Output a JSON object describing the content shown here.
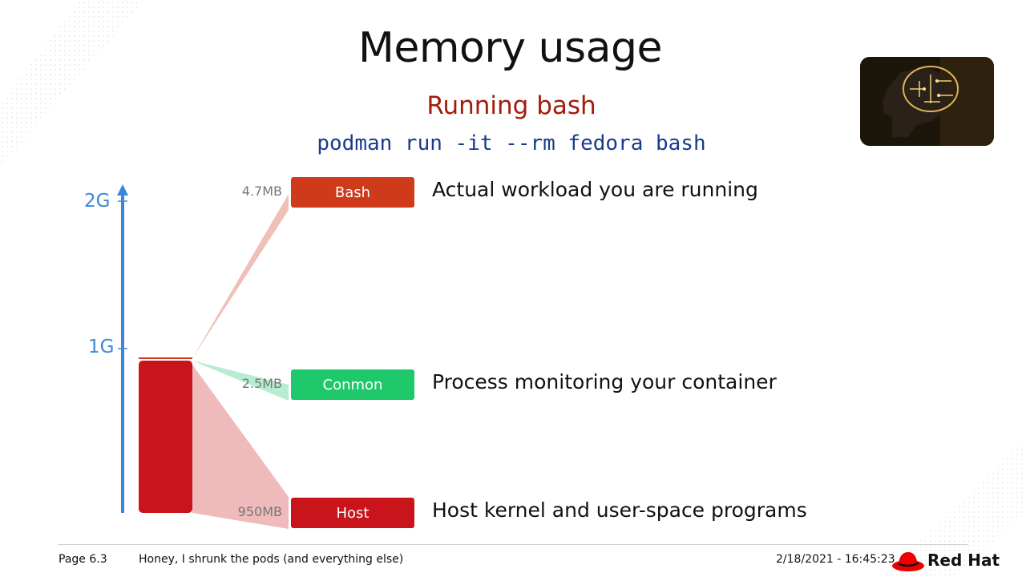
{
  "slide": {
    "title": "Memory usage",
    "subtitle": "Running bash",
    "command": "podman run -it --rm fedora bash"
  },
  "axis": {
    "labels": [
      "2G",
      "1G"
    ],
    "color": "#3b86db"
  },
  "components": [
    {
      "name": "Bash",
      "size": "4.7MB",
      "description": "Actual workload you are running",
      "color": "#cf3b1a"
    },
    {
      "name": "Conmon",
      "size": "2.5MB",
      "description": "Process monitoring your container",
      "color": "#1ec86b"
    },
    {
      "name": "Host",
      "size": "950MB",
      "description": "Host kernel and user-space programs",
      "color": "#c8141a"
    }
  ],
  "footer": {
    "page": "Page 6.3",
    "talk_title": "Honey, I shrunk the pods (and everything else)",
    "datetime": "2/18/2021 - 16:45:23",
    "brand": "Red Hat"
  }
}
